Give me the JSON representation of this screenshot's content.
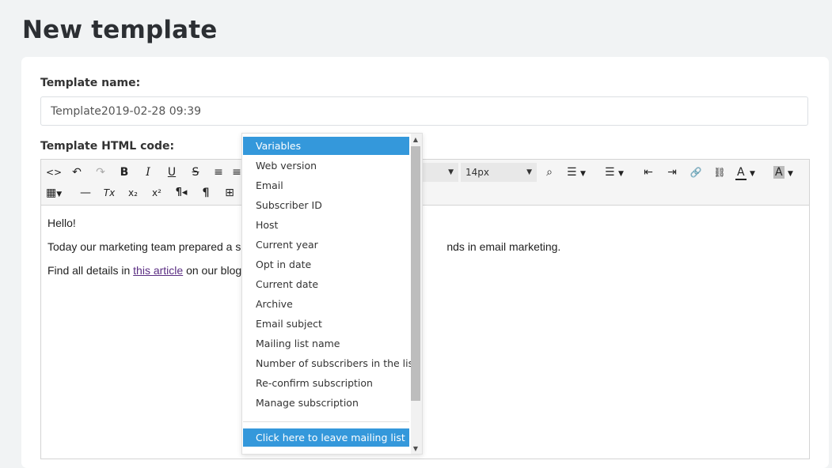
{
  "page": {
    "title": "New template"
  },
  "form": {
    "name_label": "Template name:",
    "name_value": "Template2019-02-28 09:39",
    "html_label": "Template HTML code:"
  },
  "toolbar": {
    "buttons": [
      {
        "name": "source-code-icon",
        "glyph": "<>"
      },
      {
        "name": "undo-icon",
        "glyph": "↶"
      },
      {
        "name": "redo-icon",
        "glyph": "↷"
      },
      {
        "name": "bold-icon",
        "glyph": "B"
      },
      {
        "name": "italic-icon",
        "glyph": "I"
      },
      {
        "name": "underline-icon",
        "glyph": "U"
      },
      {
        "name": "strikethrough-icon",
        "glyph": "S"
      },
      {
        "name": "align-left-icon",
        "glyph": "≡"
      },
      {
        "name": "align-center-icon",
        "glyph": "≡"
      },
      {
        "name": "find-icon",
        "glyph": "⌕"
      },
      {
        "name": "bullet-list-icon",
        "glyph": "☰"
      },
      {
        "name": "numbered-list-icon",
        "glyph": "☰"
      },
      {
        "name": "outdent-icon",
        "glyph": "⇤"
      },
      {
        "name": "indent-icon",
        "glyph": "⇥"
      },
      {
        "name": "link-icon",
        "glyph": "🔗"
      },
      {
        "name": "unlink-icon",
        "glyph": "⛓"
      },
      {
        "name": "text-color-icon",
        "glyph": "A"
      },
      {
        "name": "background-color-icon",
        "glyph": "A"
      },
      {
        "name": "table-icon",
        "glyph": "▦"
      },
      {
        "name": "horizontal-rule-icon",
        "glyph": "—"
      },
      {
        "name": "clear-format-icon",
        "glyph": "Tx"
      },
      {
        "name": "subscript-icon",
        "glyph": "x₂"
      },
      {
        "name": "superscript-icon",
        "glyph": "x²"
      },
      {
        "name": "ltr-paragraph-icon",
        "glyph": "¶◂"
      },
      {
        "name": "paragraph-icon",
        "glyph": "¶"
      },
      {
        "name": "insert-variable-icon",
        "glyph": "⊞"
      }
    ],
    "font_size": "14px"
  },
  "editor": {
    "line1": "Hello!",
    "line2_start": "Today our marketing team prepared a s",
    "line2_end": "nds in email marketing.",
    "line3_start": "Find all details in ",
    "line3_link": "this article",
    "line3_end": " on our blog"
  },
  "variables_menu": {
    "items": [
      "Variables",
      "Web version",
      "Email",
      "Subscriber ID",
      "Host",
      "Current year",
      "Opt in date",
      "Current date",
      "Archive",
      "Email subject",
      "Mailing list name",
      "Number of subscribers in the list",
      "Re-confirm subscription",
      "Manage subscription"
    ],
    "footer_item": "Click here to leave mailing list"
  },
  "colors": {
    "accent": "#3498db",
    "link": "#5a2d82"
  }
}
